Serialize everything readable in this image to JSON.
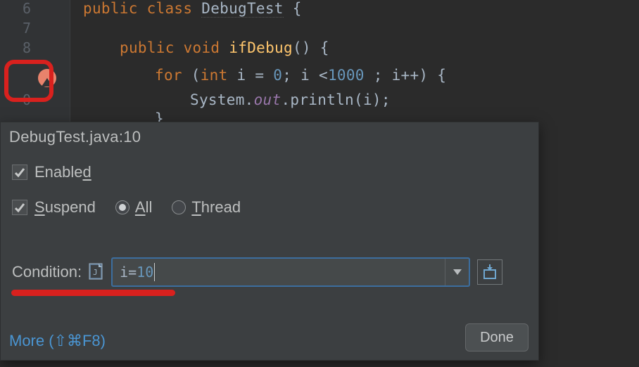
{
  "editor": {
    "line_numbers": {
      "l6": "6",
      "l7": "7",
      "l8": "8",
      "l9": "",
      "l10": "0"
    },
    "code": {
      "l6": {
        "kw1": "public class ",
        "name": "DebugTest",
        "brace": " {"
      },
      "l8": {
        "kw1": "public void ",
        "method": "ifDebug",
        "rest": "() {"
      },
      "l9": {
        "for": "for ",
        "open": "(",
        "intkw": "int ",
        "var": "i = ",
        "zero": "0",
        "sc1": "; i <",
        "thou": "1000 ",
        "sc2": "; i++) {"
      },
      "l10": {
        "sys": "System.",
        "out": "out",
        "dot": ".println(i);"
      },
      "l11": {
        "brace": "}"
      }
    }
  },
  "popup": {
    "title": "DebugTest.java:10",
    "enabled_label_pre": "Enable",
    "enabled_label_mn": "d",
    "suspend_label_mn": "S",
    "suspend_label_post": "uspend",
    "all_mn": "A",
    "all_post": "ll",
    "thread_mn": "T",
    "thread_post": "hread",
    "condition_label": "Condition:",
    "condition_var": "i",
    "condition_eq": "=",
    "condition_val": "10",
    "more_pre": "More (",
    "more_key": "⇧⌘F8",
    "more_post": ")",
    "done": "Done"
  }
}
